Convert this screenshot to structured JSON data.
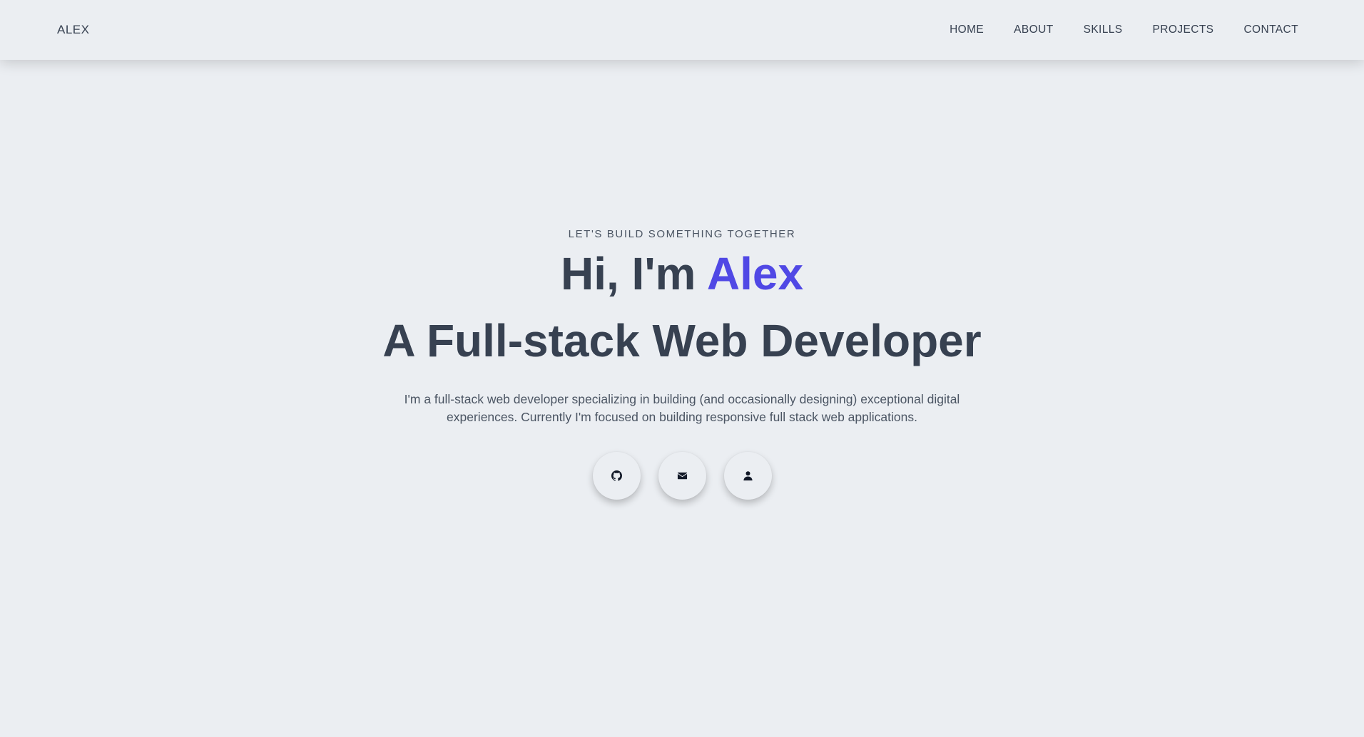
{
  "nav": {
    "brand": "ALEX",
    "links": [
      "HOME",
      "ABOUT",
      "SKILLS",
      "PROJECTS",
      "CONTACT"
    ]
  },
  "hero": {
    "tagline": "LET'S BUILD SOMETHING TOGETHER",
    "greeting": "Hi, I'm",
    "name": "Alex",
    "title": "A Full-stack Web Developer",
    "description": "I'm a full-stack web developer specializing in building (and occasionally designing) exceptional digital experiences. Currently I'm focused on building responsive full stack web applications."
  },
  "socials": [
    {
      "icon": "github-icon"
    },
    {
      "icon": "mail-icon"
    },
    {
      "icon": "user-icon"
    }
  ],
  "colors": {
    "background": "#ebeef2",
    "text": "#374151",
    "accent": "#5048e5"
  }
}
